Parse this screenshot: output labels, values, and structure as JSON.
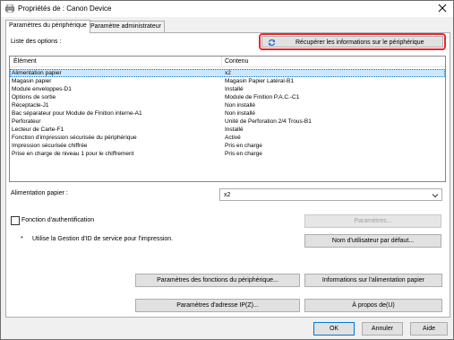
{
  "window": {
    "title": "Propriétés de : Canon Device",
    "close_glyph": "✕",
    "app_icon": "printer-icon"
  },
  "tabs": [
    {
      "label": "Paramètres du périphérique",
      "active": true
    },
    {
      "label": "Paramètre administrateur",
      "active": false
    }
  ],
  "options": {
    "list_label": "Liste des options :",
    "refresh_button": "Récupérer les informations sur le périphérique",
    "refresh_icon": "refresh-icon",
    "highlight_color": "#e8262d",
    "columns": [
      "Élément",
      "Contenu"
    ],
    "rows": [
      {
        "item": "Alimentation papier",
        "value": "x2"
      },
      {
        "item": "Magasin papier",
        "value": "Magasin Papier Latéral-B1"
      },
      {
        "item": "Module enveloppes-D1",
        "value": "Installé"
      },
      {
        "item": "Options de sortie",
        "value": "Module de Finition P.A.C.-C1"
      },
      {
        "item": "Réceptacle-J1",
        "value": "Non installé"
      },
      {
        "item": "Bac séparateur pour Module de Finition interne-A1",
        "value": "Non installé"
      },
      {
        "item": "Perforateur",
        "value": "Unité de Perforation 2/4 Trous-B1"
      },
      {
        "item": "Lecteur de Carte-F1",
        "value": "Installé"
      },
      {
        "item": "Fonction d'impression sécurisée du périphérique",
        "value": "Activé"
      },
      {
        "item": "Impression sécurisée chiffrée",
        "value": "Pris en charge"
      },
      {
        "item": "Prise en charge de niveau 1 pour le chiffrement",
        "value": "Pris en charge"
      }
    ],
    "selected_row": 0
  },
  "paper_feed": {
    "label": "Alimentation papier :",
    "value": "x2"
  },
  "authentication": {
    "checkbox_label": "Fonction d'authentification",
    "checked": false,
    "settings_button": "Paramètres...",
    "note_bullet": "*",
    "note": "Utilise la Gestion d'ID de service pour l'impression.",
    "default_user_button": "Nom d'utilisateur par défaut..."
  },
  "bottom_buttons": {
    "device_functions": "Paramètres des fonctions du périphérique...",
    "paper_source_info": "Informations sur l'alimentation papier",
    "ip_address": "Paramètres d'adresse IP(Z)...",
    "about": "À propos de(U)"
  },
  "dialog_buttons": {
    "ok": "OK",
    "cancel": "Annuler",
    "help": "Aide"
  },
  "colors": {
    "selection": "#cce8ff",
    "window_bg": "#f0f0f0",
    "button_bg": "#e1e1e1"
  }
}
